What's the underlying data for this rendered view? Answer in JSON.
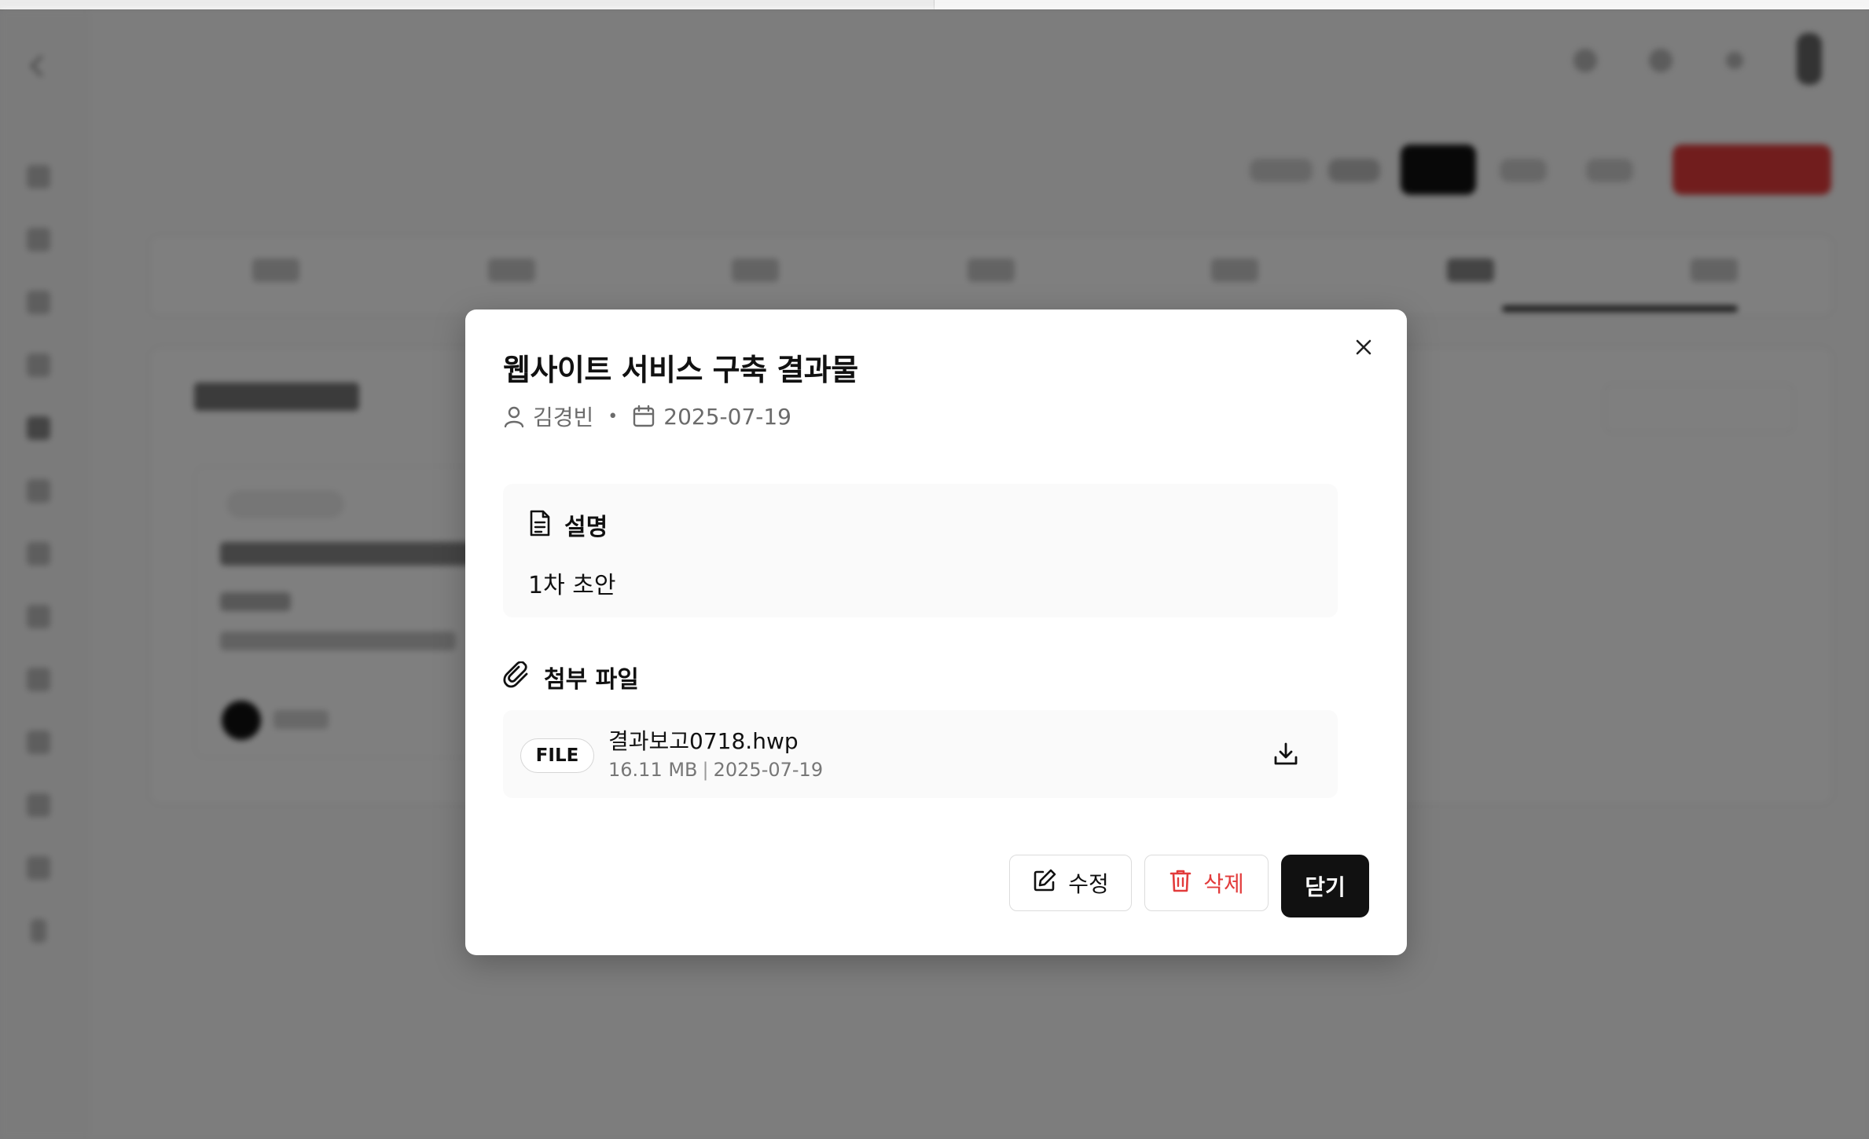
{
  "modal": {
    "title": "웹사이트 서비스 구축 결과물",
    "author": "김경빈",
    "date": "2025-07-19",
    "description_label": "설명",
    "description_text": "1차 초안",
    "attachments_label": "첨부 파일",
    "file": {
      "badge": "FILE",
      "name": "결과보고0718.hwp",
      "size": "16.11 MB",
      "date": "2025-07-19"
    },
    "buttons": {
      "edit": "수정",
      "delete": "삭제",
      "close": "닫기"
    }
  },
  "colors": {
    "danger": "#e23b3b",
    "primary_dark": "#111111",
    "overlay": "rgba(0,0,0,0.5)"
  },
  "icons": [
    "close-icon",
    "user-icon",
    "calendar-icon",
    "document-icon",
    "paperclip-icon",
    "download-icon",
    "edit-icon",
    "trash-icon"
  ]
}
